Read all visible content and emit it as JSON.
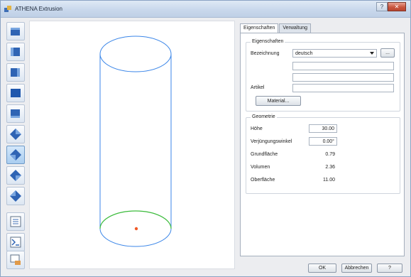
{
  "window": {
    "title": "ATHENA Extrusion",
    "help_glyph": "?",
    "close_glyph": "✕"
  },
  "toolbar": {
    "buttons": [
      {
        "name": "view-front-icon"
      },
      {
        "name": "view-back-icon"
      },
      {
        "name": "view-left-icon"
      },
      {
        "name": "view-right-icon"
      },
      {
        "name": "view-top-icon"
      },
      {
        "name": "view-iso-1-icon"
      },
      {
        "name": "view-iso-2-icon"
      },
      {
        "name": "view-iso-3-icon"
      },
      {
        "name": "view-iso-4-icon"
      },
      {
        "name": "properties-icon"
      },
      {
        "name": "zoom-fit-icon"
      },
      {
        "name": "export-icon"
      }
    ],
    "active_index": 6
  },
  "tabs": {
    "active": "Eigenschaften",
    "items": [
      "Eigenschaften",
      "Verwaltung"
    ]
  },
  "properties": {
    "group_title": "Eigenschaften",
    "bezeichnung_label": "Bezeichnung",
    "bezeichnung_value": "deutsch",
    "ellipsis_label": "...",
    "artikel_label": "Artikel",
    "material_button": "Material..."
  },
  "geometry": {
    "group_title": "Geometrie",
    "rows": [
      {
        "label": "Höhe",
        "value": "30.00",
        "editable": true
      },
      {
        "label": "Verjüngungswinkel",
        "value": "0.00°",
        "editable": true
      },
      {
        "label": "Grundfläche",
        "value": "0.79",
        "editable": false
      },
      {
        "label": "Volumen",
        "value": "2.36",
        "editable": false
      },
      {
        "label": "Oberfläche",
        "value": "11.00",
        "editable": false
      }
    ]
  },
  "footer": {
    "ok": "OK",
    "cancel": "Abbrechen",
    "help": "?"
  },
  "colors": {
    "cylinder": "#3b86e8",
    "base_edge": "#3bbb3b",
    "origin_point": "#f05a28"
  }
}
